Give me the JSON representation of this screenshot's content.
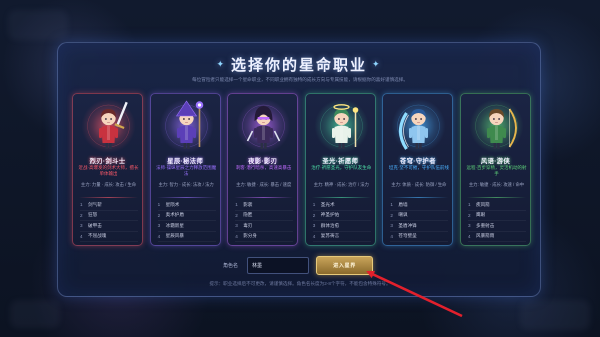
{
  "title": "选择你的星命职业",
  "title_ornament": "✦",
  "subtitle": "每位冒险者只能选择一个星命职业，不同职业拥有独特的成长方向与专属技能，请根据你的喜好谨慎选择。",
  "classes": [
    {
      "name": "烈刃·剑斗士",
      "desc": "近战·高爆发的剑术大师，擅长单体输出",
      "stats": "主力: 力量 · 成长: 攻击 / 生命",
      "skills": [
        {
          "no": "1",
          "name": "剑气斩"
        },
        {
          "no": "2",
          "name": "狂怒"
        },
        {
          "no": "3",
          "name": "破甲击"
        },
        {
          "no": "4",
          "name": "不屈战魂"
        }
      ],
      "color": "#ff5a6a",
      "hair": "#6a2a2a",
      "outfit": "#c8323f",
      "weapon": "sword"
    },
    {
      "name": "星辰·秘法师",
      "desc": "法师·操纵星辰之力释放范围魔法",
      "stats": "主力: 智力 · 成长: 法攻 / 法力",
      "skills": [
        {
          "no": "1",
          "name": "星陨术"
        },
        {
          "no": "2",
          "name": "奥术护盾"
        },
        {
          "no": "3",
          "name": "冰霜新星"
        },
        {
          "no": "4",
          "name": "星辰风暴"
        }
      ],
      "color": "#9a72ff",
      "hair": "#3a2a6a",
      "outfit": "#5b3fb8",
      "weapon": "staff"
    },
    {
      "name": "夜影·影刃",
      "desc": "刺客·潜行暗杀，高速高暴击",
      "stats": "主力: 敏捷 · 成长: 暴击 / 速度",
      "skills": [
        {
          "no": "1",
          "name": "影袭"
        },
        {
          "no": "2",
          "name": "隐匿"
        },
        {
          "no": "3",
          "name": "毒刃"
        },
        {
          "no": "4",
          "name": "影分身"
        }
      ],
      "color": "#c06cff",
      "hair": "#241a38",
      "outfit": "#3a2a5a",
      "weapon": "dagger"
    },
    {
      "name": "圣光·祈愿师",
      "desc": "治疗·祈愿圣光，守护队友生命",
      "stats": "主力: 精神 · 成长: 治疗 / 法力",
      "skills": [
        {
          "no": "1",
          "name": "圣光术"
        },
        {
          "no": "2",
          "name": "神圣护佑"
        },
        {
          "no": "3",
          "name": "群体治愈"
        },
        {
          "no": "4",
          "name": "复苏祷言"
        }
      ],
      "color": "#4fe0a8",
      "hair": "#3c8a5c",
      "outfit": "#e8f2ea",
      "weapon": "holy-staff"
    },
    {
      "name": "苍穹·守护者",
      "desc": "坦克·坚不可摧，守护队伍前线",
      "stats": "主力: 体质 · 成长: 防御 / 生命",
      "skills": [
        {
          "no": "1",
          "name": "盾墙"
        },
        {
          "no": "2",
          "name": "嘲讽"
        },
        {
          "no": "3",
          "name": "圣盾冲锋"
        },
        {
          "no": "4",
          "name": "苍穹壁垒"
        }
      ],
      "color": "#4cb2ff",
      "hair": "#2a5a9a",
      "outfit": "#8fc6ef",
      "weapon": "shield"
    },
    {
      "name": "风语·游侠",
      "desc": "远程·百步穿杨，灵活机动的射手",
      "stats": "主力: 敏捷 · 成长: 攻速 / 命中",
      "skills": [
        {
          "no": "1",
          "name": "疾风箭"
        },
        {
          "no": "2",
          "name": "鹰眼"
        },
        {
          "no": "3",
          "name": "多重射击"
        },
        {
          "no": "4",
          "name": "风暴箭雨"
        }
      ],
      "color": "#5fd47a",
      "hair": "#6a4a2a",
      "outfit": "#3f8a4e",
      "weapon": "bow"
    }
  ],
  "character": {
    "name_label": "角色名",
    "name_value": "林墨",
    "confirm_label": "进入星界"
  },
  "footer_note": "提示：职业选择后不可更改，请谨慎选择。角色名长度为2-8个字符，不能包含特殊符号。",
  "annotation": {
    "arrow_color": "#e2202c"
  }
}
